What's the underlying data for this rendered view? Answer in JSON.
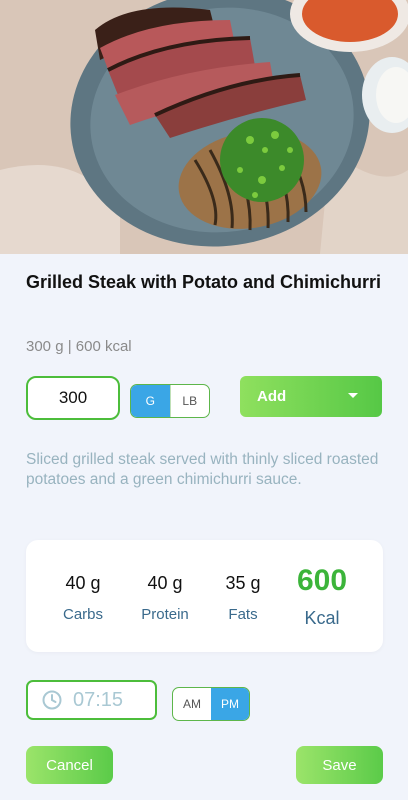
{
  "product": {
    "title": "Grilled Steak with Potato and Chimichurri",
    "summary": "300 g | 600 kcal",
    "description": "Sliced grilled steak served with thinly sliced roasted potatoes and a green chimichurri sauce."
  },
  "quantity": {
    "value": "300",
    "units": [
      "G",
      "LB"
    ],
    "selected_unit": "G"
  },
  "add_button": {
    "label": "Add"
  },
  "nutrition": [
    {
      "value": "40 g",
      "label": "Carbs"
    },
    {
      "value": "40 g",
      "label": "Protein"
    },
    {
      "value": "35 g",
      "label": "Fats"
    },
    {
      "value": "600",
      "label": "Kcal"
    }
  ],
  "time": {
    "value": "07:15",
    "periods": [
      "AM",
      "PM"
    ],
    "selected_period": "PM"
  },
  "actions": {
    "cancel_label": "Cancel",
    "save_label": "Save"
  },
  "colors": {
    "accent_green": "#4cbd3b",
    "selected_blue": "#3aa6e6",
    "kcal_green": "#3cb43a",
    "page_bg": "#f1f4fb"
  },
  "icons": {
    "time_field": "clock-icon",
    "add_dropdown": "caret-down-icon"
  }
}
